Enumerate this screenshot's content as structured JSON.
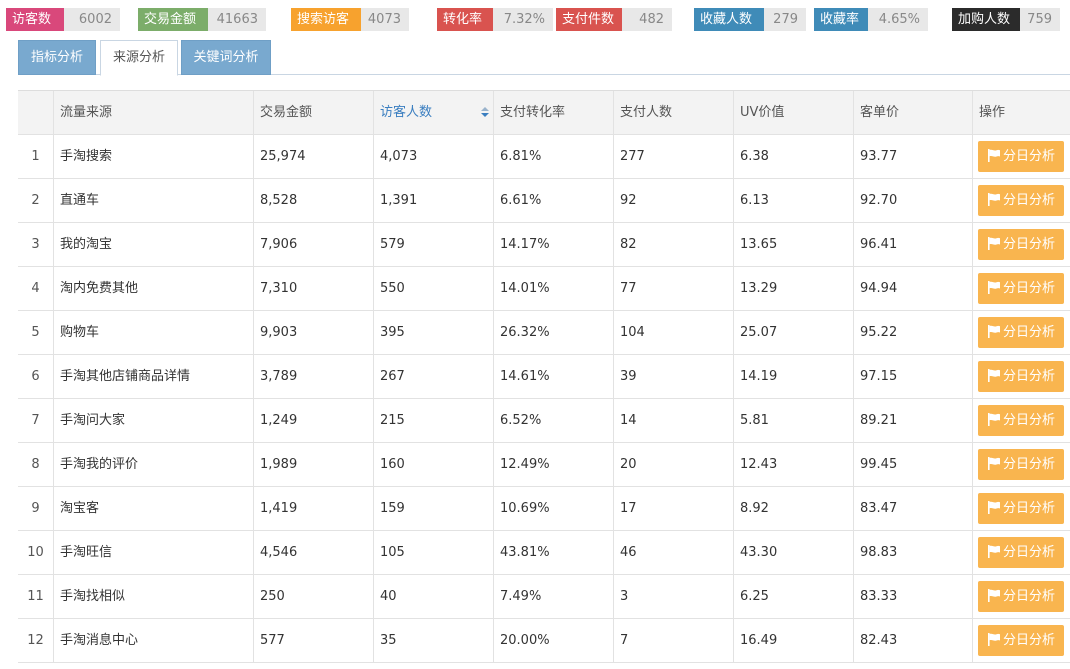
{
  "metrics": [
    {
      "label": "访客数",
      "value": "6002",
      "color": "#d9487b"
    },
    {
      "label": "交易金额",
      "value": "41663",
      "color": "#7cad6a"
    },
    {
      "label": "搜索访客",
      "value": "4073",
      "color": "#f7a22e"
    },
    {
      "label": "转化率",
      "value": "7.32%",
      "color": "#d9534f"
    },
    {
      "label": "支付件数",
      "value": "482",
      "color": "#d9534f"
    },
    {
      "label": "收藏人数",
      "value": "279",
      "color": "#3f8bb8"
    },
    {
      "label": "收藏率",
      "value": "4.65%",
      "color": "#3f8bb8"
    },
    {
      "label": "加购人数",
      "value": "759",
      "color": "#2b2b2b"
    }
  ],
  "tabs": [
    {
      "label": "指标分析",
      "active": false
    },
    {
      "label": "来源分析",
      "active": true
    },
    {
      "label": "关键词分析",
      "active": false
    }
  ],
  "table": {
    "headers": [
      "",
      "流量来源",
      "交易金额",
      "访客人数",
      "支付转化率",
      "支付人数",
      "UV价值",
      "客单价",
      "操作"
    ],
    "sorted_column": "访客人数",
    "action_label": "分日分析",
    "rows": [
      {
        "idx": "1",
        "source": "手淘搜索",
        "amount": "25,974",
        "visitors": "4,073",
        "conv": "6.81%",
        "payers": "277",
        "uv": "6.38",
        "aov": "93.77"
      },
      {
        "idx": "2",
        "source": "直通车",
        "amount": "8,528",
        "visitors": "1,391",
        "conv": "6.61%",
        "payers": "92",
        "uv": "6.13",
        "aov": "92.70"
      },
      {
        "idx": "3",
        "source": "我的淘宝",
        "amount": "7,906",
        "visitors": "579",
        "conv": "14.17%",
        "payers": "82",
        "uv": "13.65",
        "aov": "96.41"
      },
      {
        "idx": "4",
        "source": "淘内免费其他",
        "amount": "7,310",
        "visitors": "550",
        "conv": "14.01%",
        "payers": "77",
        "uv": "13.29",
        "aov": "94.94"
      },
      {
        "idx": "5",
        "source": "购物车",
        "amount": "9,903",
        "visitors": "395",
        "conv": "26.32%",
        "payers": "104",
        "uv": "25.07",
        "aov": "95.22"
      },
      {
        "idx": "6",
        "source": "手淘其他店铺商品详情",
        "amount": "3,789",
        "visitors": "267",
        "conv": "14.61%",
        "payers": "39",
        "uv": "14.19",
        "aov": "97.15"
      },
      {
        "idx": "7",
        "source": "手淘问大家",
        "amount": "1,249",
        "visitors": "215",
        "conv": "6.52%",
        "payers": "14",
        "uv": "5.81",
        "aov": "89.21"
      },
      {
        "idx": "8",
        "source": "手淘我的评价",
        "amount": "1,989",
        "visitors": "160",
        "conv": "12.49%",
        "payers": "20",
        "uv": "12.43",
        "aov": "99.45"
      },
      {
        "idx": "9",
        "source": "淘宝客",
        "amount": "1,419",
        "visitors": "159",
        "conv": "10.69%",
        "payers": "17",
        "uv": "8.92",
        "aov": "83.47"
      },
      {
        "idx": "10",
        "source": "手淘旺信",
        "amount": "4,546",
        "visitors": "105",
        "conv": "43.81%",
        "payers": "46",
        "uv": "43.30",
        "aov": "98.83"
      },
      {
        "idx": "11",
        "source": "手淘找相似",
        "amount": "250",
        "visitors": "40",
        "conv": "7.49%",
        "payers": "3",
        "uv": "6.25",
        "aov": "83.33"
      },
      {
        "idx": "12",
        "source": "手淘消息中心",
        "amount": "577",
        "visitors": "35",
        "conv": "20.00%",
        "payers": "7",
        "uv": "16.49",
        "aov": "82.43"
      }
    ]
  }
}
